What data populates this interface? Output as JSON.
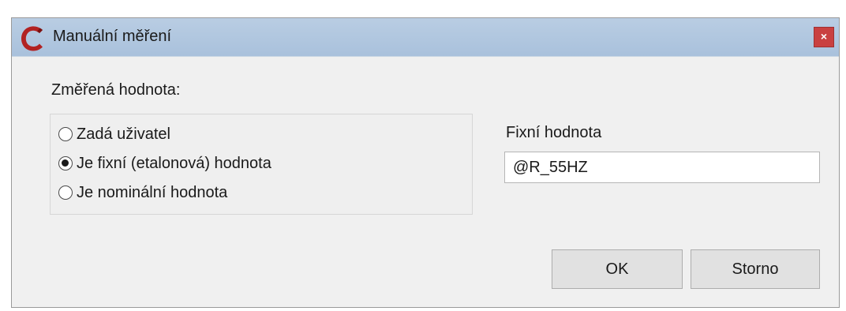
{
  "window": {
    "title": "Manuální měření",
    "close_label": "×",
    "icon": "app-logo-icon",
    "accent_color": "#b22222"
  },
  "measured_value": {
    "label": "Změřená hodnota:",
    "options": [
      {
        "label": "Zadá uživatel",
        "checked": false
      },
      {
        "label": "Je fixní (etalonová) hodnota",
        "checked": true
      },
      {
        "label": "Je nominální hodnota",
        "checked": false
      }
    ]
  },
  "fixed_value": {
    "label": "Fixní hodnota",
    "value": "@R_55HZ"
  },
  "buttons": {
    "ok_label": "OK",
    "cancel_label": "Storno"
  }
}
